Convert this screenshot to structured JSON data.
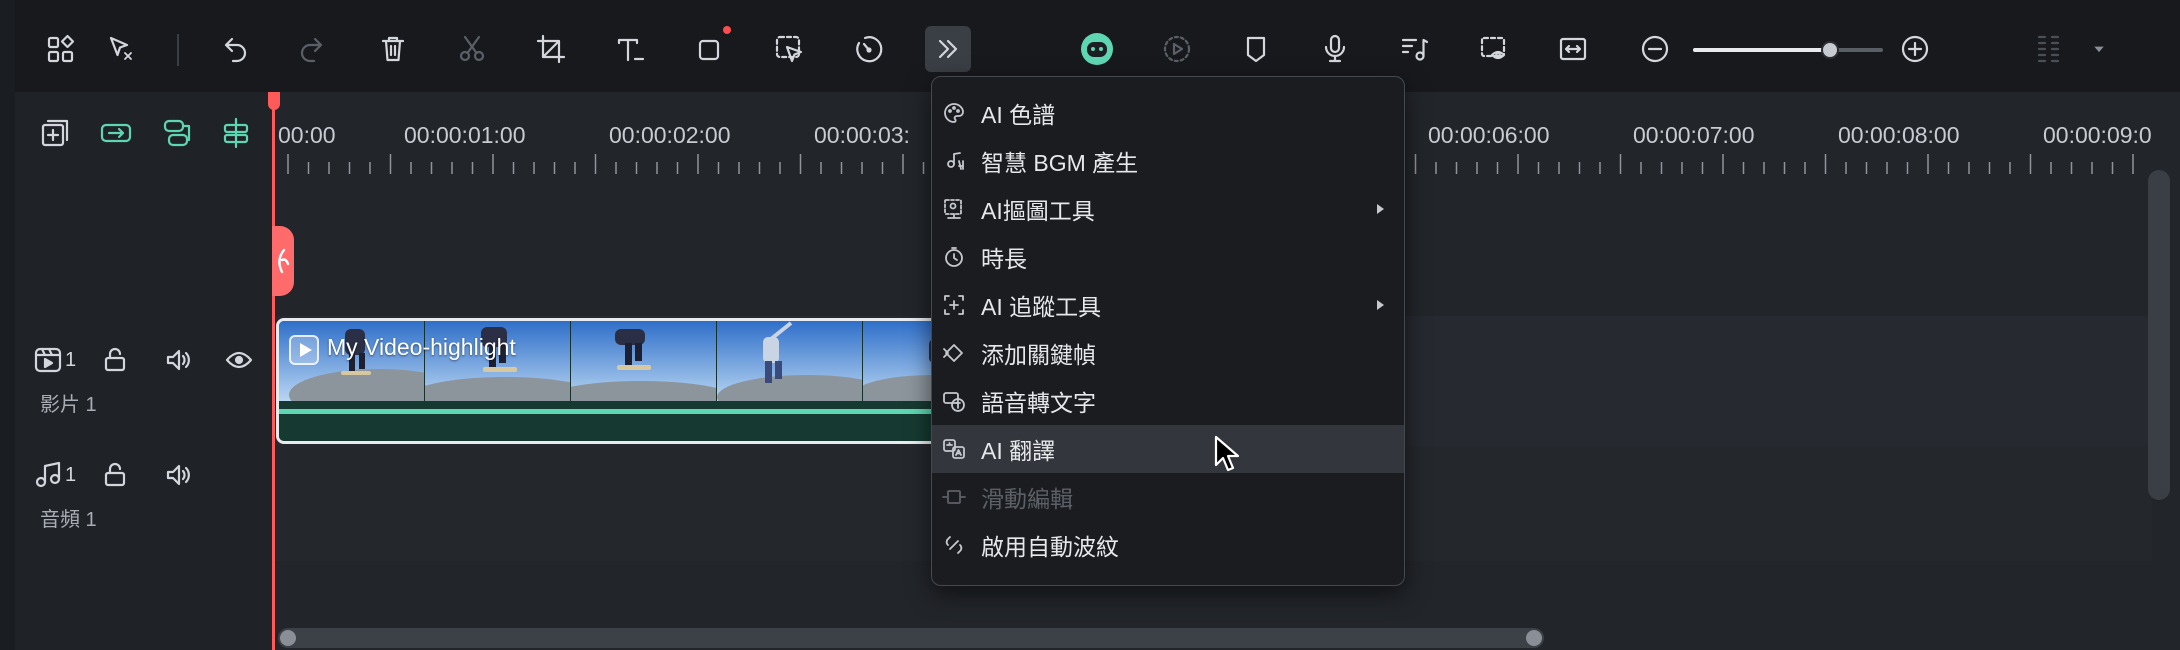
{
  "toolbar": {
    "buttons": [
      {
        "name": "layout-icon"
      },
      {
        "name": "select-cursor-icon"
      },
      {
        "name": "undo-icon"
      },
      {
        "name": "redo-icon"
      },
      {
        "name": "delete-icon"
      },
      {
        "name": "cut-icon"
      },
      {
        "name": "crop-icon"
      },
      {
        "name": "text-icon"
      },
      {
        "name": "shape-icon"
      },
      {
        "name": "ai-select-icon"
      },
      {
        "name": "speed-icon"
      },
      {
        "name": "more-tools-icon"
      },
      {
        "name": "ai-robot-icon"
      },
      {
        "name": "render-preview-icon"
      },
      {
        "name": "marker-icon"
      },
      {
        "name": "microphone-icon"
      },
      {
        "name": "audio-ducking-icon"
      },
      {
        "name": "preview-quality-icon"
      },
      {
        "name": "fit-timeline-icon"
      },
      {
        "name": "zoom-out-icon"
      },
      {
        "name": "zoom-in-icon"
      },
      {
        "name": "grid-menu-icon"
      }
    ],
    "zoom_level": 0.72
  },
  "timeline": {
    "timecodes": [
      "00:00",
      "00:00:01:00",
      "00:00:02:00",
      "00:00:03:",
      "00:00:06:00",
      "00:00:07:00",
      "00:00:08:00",
      "00:00:09:0"
    ]
  },
  "tracks": {
    "video": {
      "number": "1",
      "name": "影片 1"
    },
    "audio": {
      "number": "1",
      "name": "音頻 1"
    }
  },
  "clip": {
    "title": "My Video-highlight"
  },
  "menu": {
    "items": [
      {
        "label": "AI 色譜",
        "icon": "palette-icon",
        "submenu": false,
        "disabled": false
      },
      {
        "label": "智慧 BGM 產生",
        "icon": "ai-music-icon",
        "submenu": false,
        "disabled": false
      },
      {
        "label": "AI摳圖工具",
        "icon": "ai-cutout-icon",
        "submenu": true,
        "disabled": false
      },
      {
        "label": "時長",
        "icon": "timer-icon",
        "submenu": false,
        "disabled": false
      },
      {
        "label": "AI 追蹤工具",
        "icon": "tracking-icon",
        "submenu": true,
        "disabled": false
      },
      {
        "label": "添加關鍵幀",
        "icon": "keyframe-icon",
        "submenu": false,
        "disabled": false
      },
      {
        "label": "語音轉文字",
        "icon": "speech-to-text-icon",
        "submenu": false,
        "disabled": false
      },
      {
        "label": "AI 翻譯",
        "icon": "translate-icon",
        "submenu": false,
        "disabled": false,
        "hovered": true
      },
      {
        "label": "滑動編輯",
        "icon": "slide-edit-icon",
        "submenu": false,
        "disabled": true
      },
      {
        "label": "啟用自動波紋",
        "icon": "ripple-icon",
        "submenu": false,
        "disabled": false
      }
    ]
  },
  "colors": {
    "accent": "#5fd6b2",
    "playhead": "#ff5a5a",
    "notification": "#ff4d4d"
  }
}
